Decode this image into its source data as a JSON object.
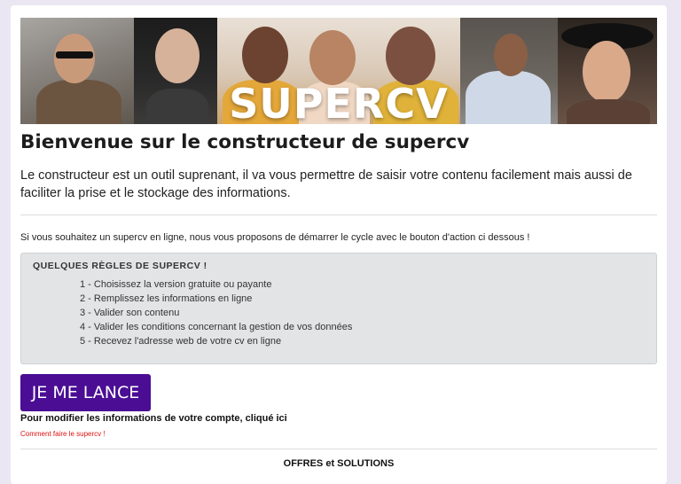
{
  "banner": {
    "title": "SUPERCV",
    "photos": [
      "man-glasses-photo",
      "smiling-man-photo",
      "three-women-laughing-photo",
      "man-shirt-photo",
      "woman-hat-photo"
    ]
  },
  "page": {
    "heading": "Bienvenue sur le constructeur de supercv",
    "intro": "Le constructeur est un outil suprenant, il va vous permettre de saisir votre contenu facilement mais aussi de faciliter la prise et le stockage des informations.",
    "lead": "Si vous souhaitez un supercv en ligne, nous vous proposons de démarrer le cycle avec le bouton d'action ci dessous !"
  },
  "rules": {
    "title": "QUELQUES RÈGLES DE SUPERCV !",
    "items": [
      "1 - Choisissez la version gratuite ou payante",
      "2 - Remplissez les informations en ligne",
      "3 - Valider son contenu",
      "4 - Valider les conditions concernant la gestion de vos données",
      "5 - Recevez l'adresse web de votre cv en ligne"
    ]
  },
  "actions": {
    "cta_label": "JE ME LANCE",
    "account_text": "Pour modifier les informations de votre compte, cliqué ici",
    "howto_link": "Comment faire le supercv !"
  },
  "footer": {
    "offers_title": "OFFRES et SOLUTIONS"
  },
  "colors": {
    "accent": "#4a0d94",
    "link_red": "#dd1111",
    "background": "#ebe7f2"
  }
}
